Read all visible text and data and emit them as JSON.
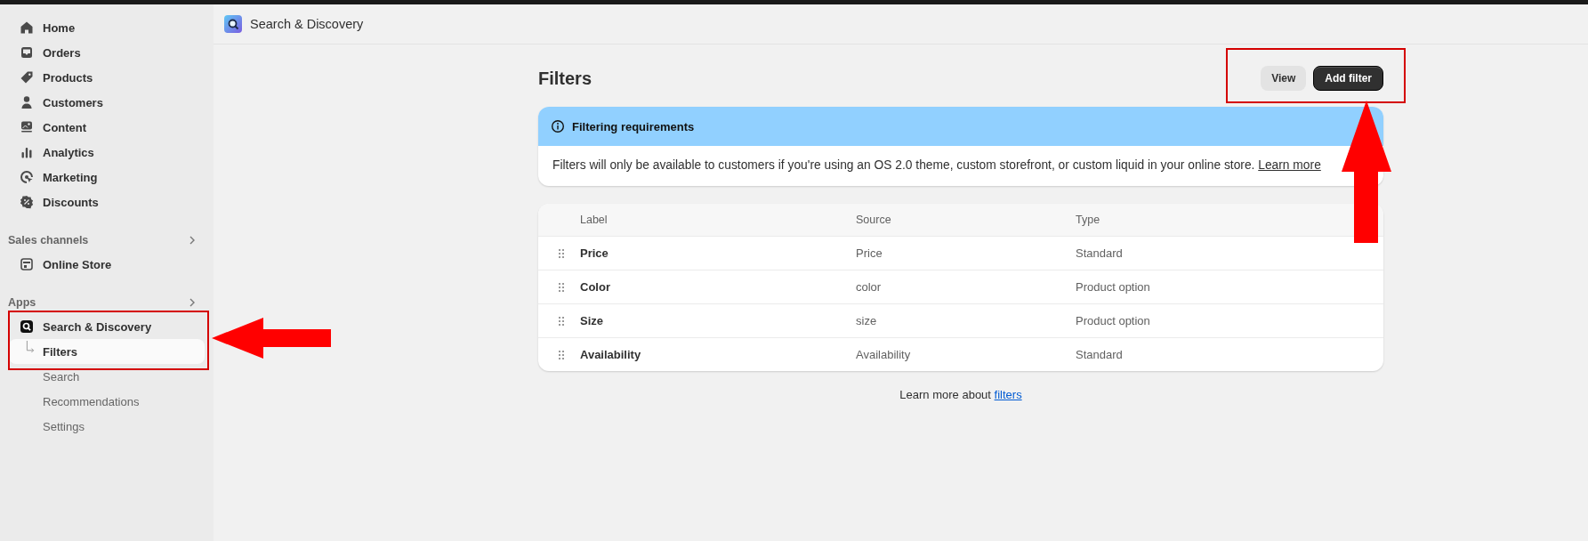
{
  "sidebar": {
    "items": [
      {
        "label": "Home",
        "kind": "home",
        "selected": false
      },
      {
        "label": "Orders",
        "kind": "inbox",
        "selected": false
      },
      {
        "label": "Products",
        "kind": "tag",
        "selected": false
      },
      {
        "label": "Customers",
        "kind": "person",
        "selected": false
      },
      {
        "label": "Content",
        "kind": "content",
        "selected": false
      },
      {
        "label": "Analytics",
        "kind": "bars",
        "selected": false
      },
      {
        "label": "Marketing",
        "kind": "target",
        "selected": false
      },
      {
        "label": "Discounts",
        "kind": "discount",
        "selected": false
      }
    ],
    "sections": [
      {
        "title": "Sales channels",
        "items": [
          {
            "label": "Online Store",
            "kind": "store",
            "selected": false
          }
        ]
      },
      {
        "title": "Apps",
        "items": [
          {
            "label": "Search & Discovery",
            "kind": "app",
            "selected": false,
            "children": [
              {
                "label": "Filters",
                "selected": true
              },
              {
                "label": "Search",
                "selected": false
              },
              {
                "label": "Recommendations",
                "selected": false
              },
              {
                "label": "Settings",
                "selected": false
              }
            ]
          }
        ]
      }
    ]
  },
  "header": {
    "title": "Search & Discovery"
  },
  "page": {
    "title": "Filters",
    "buttons": [
      {
        "label": "View",
        "kind": "secondary"
      },
      {
        "label": "Add filter",
        "kind": "primary"
      }
    ]
  },
  "banner": {
    "title": "Filtering requirements",
    "text": "Filters will only be available to customers if you're using an OS 2.0 theme, custom storefront, or custom liquid in your online store.",
    "link": "Learn more"
  },
  "table": {
    "columns": [
      "Label",
      "Source",
      "Type"
    ],
    "rows": [
      [
        "Price",
        "Price",
        "Standard"
      ],
      [
        "Color",
        "color",
        "Product option"
      ],
      [
        "Size",
        "size",
        "Product option"
      ],
      [
        "Availability",
        "Availability",
        "Standard"
      ]
    ]
  },
  "footer": {
    "text": "Learn more about",
    "link": "filters"
  }
}
